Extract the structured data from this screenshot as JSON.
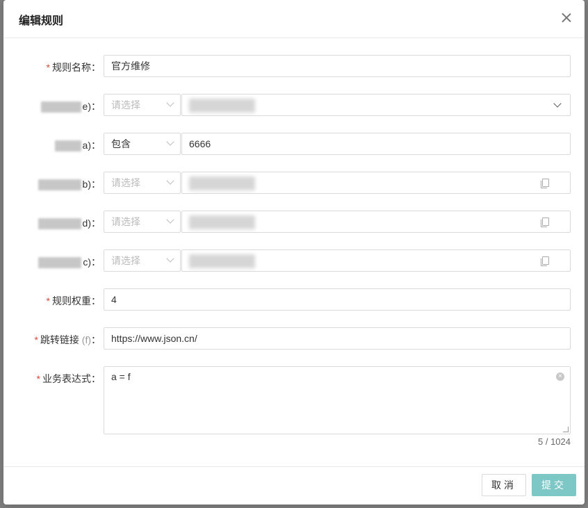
{
  "dialog": {
    "title": "编辑规则",
    "close_label": "×"
  },
  "form": {
    "required_mark": "*",
    "rule_name": {
      "label": "规则名称：",
      "value": "官方维修"
    },
    "field_e": {
      "label_suffix": "e)：",
      "operator": "请选择",
      "value": ""
    },
    "field_a": {
      "label_suffix": "a)：",
      "operator": "包含",
      "value": "6666"
    },
    "field_b": {
      "label_suffix": "b)：",
      "operator": "请选择",
      "value": ""
    },
    "field_d": {
      "label_suffix": "d)：",
      "operator": "请选择",
      "value": ""
    },
    "field_c": {
      "label_suffix": "c)：",
      "operator": "请选择",
      "value": ""
    },
    "rule_weight": {
      "label": "规则权重：",
      "value": "4"
    },
    "jump_link": {
      "label": "跳转链接",
      "hint": "(f)",
      "colon": "：",
      "value": "https://www.json.cn/"
    },
    "expression": {
      "label": "业务表达式：",
      "value": "a = f",
      "counter": "5 / 1024"
    }
  },
  "footer": {
    "cancel_label": "取消",
    "submit_label": "提交"
  },
  "colors": {
    "primary": "#7dc7c7",
    "required": "#e0463a"
  }
}
